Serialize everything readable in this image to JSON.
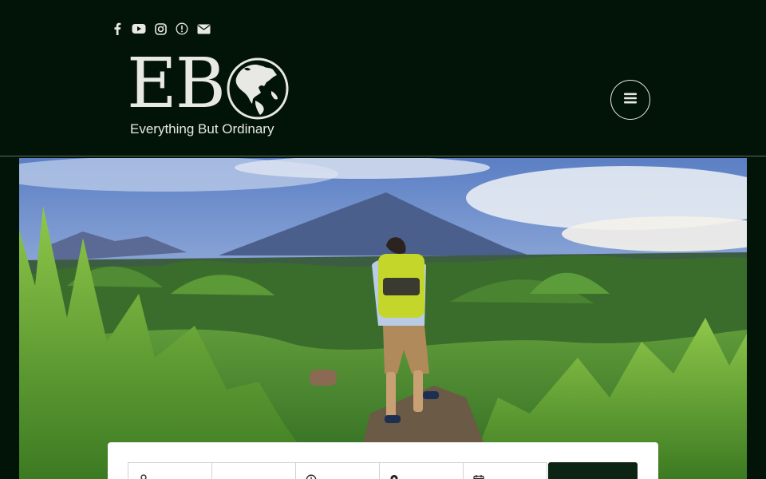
{
  "header": {
    "social_icons": [
      "facebook-icon",
      "youtube-icon",
      "instagram-icon",
      "alert-icon",
      "envelope-icon"
    ],
    "logo": {
      "letters": "EB",
      "tagline": "Everything But Ordinary"
    },
    "menu_icon": "hamburger-icon"
  },
  "hero": {
    "image": "hiker-with-backpack-on-grassy-hills-facing-volcano"
  },
  "search": {
    "field_icons": [
      "person-icon",
      "blank",
      "clock-icon",
      "pin-icon",
      "calendar-icon"
    ]
  },
  "colors": {
    "header_bg": "#021408",
    "text": "#e8e8e4",
    "button_bg": "#0c2414"
  }
}
